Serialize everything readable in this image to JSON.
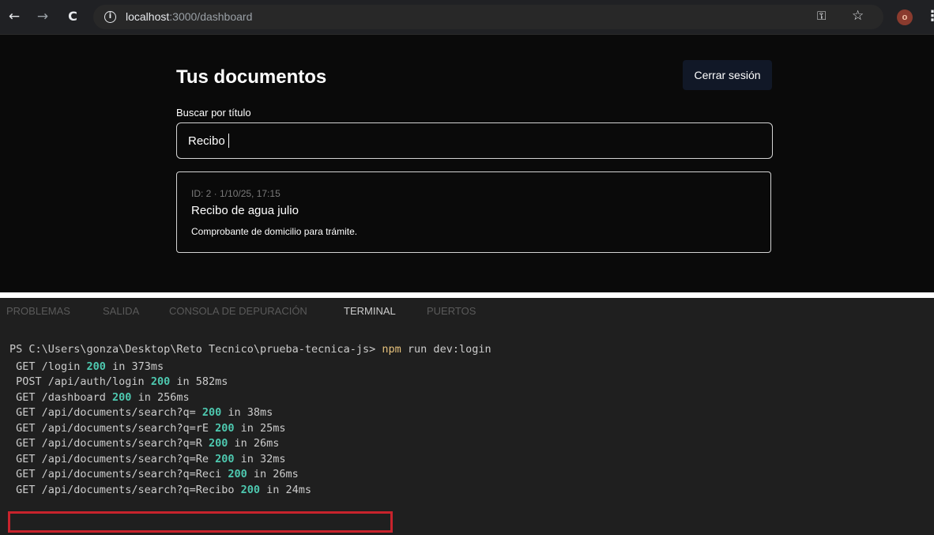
{
  "browser": {
    "back_icon": "←",
    "forward_icon": "→",
    "reload_icon": "C",
    "url_host": "localhost",
    "url_path": ":3000/dashboard",
    "key_icon": "⚿",
    "star_icon": "☆",
    "avatar_initial": "o",
    "menu_icon": "⋮"
  },
  "page": {
    "title": "Tus documentos",
    "logout_label": "Cerrar sesión",
    "search": {
      "label": "Buscar por título",
      "value": "Recibo"
    },
    "documents": [
      {
        "meta": "ID: 2 · 1/10/25, 17:15",
        "title": "Recibo de agua julio",
        "description": "Comprobante de domicilio para trámite."
      }
    ]
  },
  "terminal": {
    "tabs": [
      "PROBLEMAS",
      "SALIDA",
      "CONSOLA DE DEPURACIÓN",
      "TERMINAL",
      "PUERTOS"
    ],
    "active_tab": "TERMINAL",
    "prompt": "PS C:\\Users\\gonza\\Desktop\\Reto Tecnico\\prueba-tecnica-js> ",
    "command_name": "npm",
    "command_args": " run dev:login",
    "lines": [
      {
        "method": "GET",
        "path": "/login",
        "status": "200",
        "time": "in 373ms"
      },
      {
        "method": "POST",
        "path": "/api/auth/login",
        "status": "200",
        "time": "in 582ms"
      },
      {
        "method": "GET",
        "path": "/dashboard",
        "status": "200",
        "time": "in 256ms"
      },
      {
        "method": "GET",
        "path": "/api/documents/search?q=",
        "status": "200",
        "time": "in 38ms"
      },
      {
        "method": "GET",
        "path": "/api/documents/search?q=rE",
        "status": "200",
        "time": "in 25ms"
      },
      {
        "method": "GET",
        "path": "/api/documents/search?q=R",
        "status": "200",
        "time": "in 26ms"
      },
      {
        "method": "GET",
        "path": "/api/documents/search?q=Re",
        "status": "200",
        "time": "in 32ms"
      },
      {
        "method": "GET",
        "path": "/api/documents/search?q=Reci",
        "status": "200",
        "time": "in 26ms"
      },
      {
        "method": "GET",
        "path": "/api/documents/search?q=Recibo",
        "status": "200",
        "time": "in 24ms"
      }
    ]
  },
  "colors": {
    "status_accent": "#4ec9b0",
    "command_accent": "#e5c07b",
    "highlight_border": "#c8232c"
  }
}
